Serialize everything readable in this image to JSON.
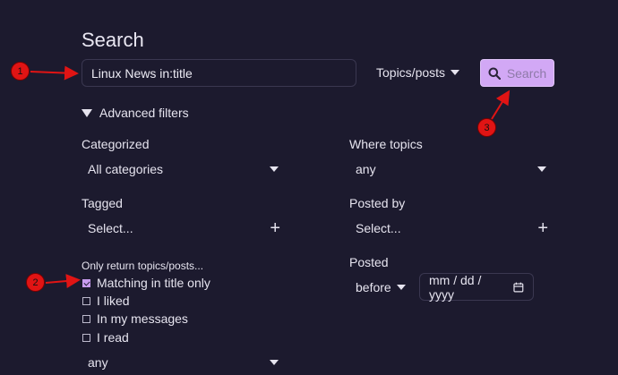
{
  "page": {
    "title": "Search"
  },
  "search": {
    "query": "Linux News in:title",
    "type_label": "Topics/posts",
    "button_label": "Search"
  },
  "advanced": {
    "toggle_label": "Advanced filters",
    "categorized": {
      "label": "Categorized",
      "value": "All categories"
    },
    "where_topics": {
      "label": "Where topics",
      "value": "any"
    },
    "tagged": {
      "label": "Tagged",
      "placeholder": "Select..."
    },
    "posted_by": {
      "label": "Posted by",
      "placeholder": "Select..."
    },
    "only_return": {
      "label": "Only return topics/posts...",
      "options": [
        {
          "label": "Matching in title only",
          "checked": true
        },
        {
          "label": "I liked",
          "checked": false
        },
        {
          "label": "In my messages",
          "checked": false
        },
        {
          "label": "I read",
          "checked": false
        }
      ],
      "select_value": "any"
    },
    "posted": {
      "label": "Posted",
      "qualifier": "before",
      "date_placeholder": "mm / dd / yyyy"
    }
  },
  "annotations": [
    "1",
    "2",
    "3"
  ],
  "colors": {
    "background": "#1c1a2e",
    "accent": "#d2a8f5",
    "marker": "#e01414"
  }
}
